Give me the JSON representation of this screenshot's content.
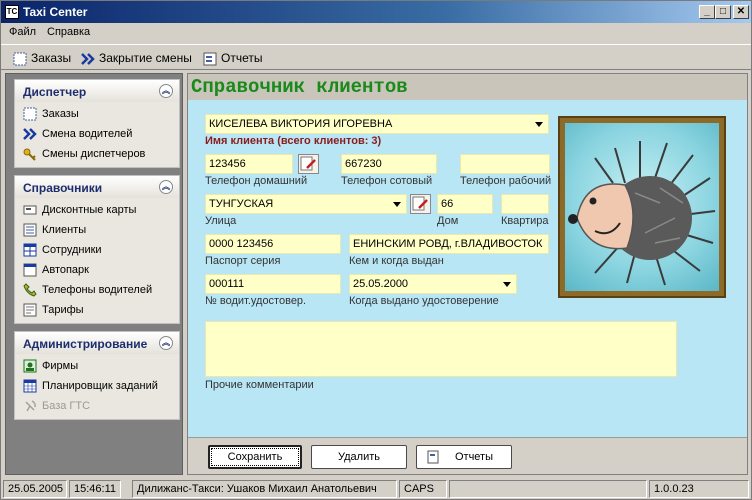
{
  "window": {
    "title": "Taxi Center",
    "minimize": "_",
    "maximize": "□",
    "close": "✕"
  },
  "menu": [
    "Файл",
    "Справка"
  ],
  "toolbar": {
    "orders": "Заказы",
    "shift_close": "Закрытие смены",
    "reports": "Отчеты"
  },
  "sidebar": {
    "dispatcher": {
      "title": "Диспетчер",
      "items": [
        "Заказы",
        "Смена водителей",
        "Смены диспетчеров"
      ]
    },
    "references": {
      "title": "Справочники",
      "items": [
        "Дисконтные карты",
        "Клиенты",
        "Сотрудники",
        "Автопарк",
        "Телефоны водителей",
        "Тарифы"
      ]
    },
    "admin": {
      "title": "Администрирование",
      "items": [
        "Фирмы",
        "Планировщик заданий",
        "База ГТС"
      ]
    }
  },
  "main": {
    "heading": "Справочник клиентов",
    "client_name": "КИСЕЛЕВА ВИКТОРИЯ ИГОРЕВНА",
    "client_name_label": "Имя клиента (всего клиентов: 3)",
    "phone_home": "123456",
    "phone_home_label": "Телефон домашний",
    "phone_mobile": "667230",
    "phone_mobile_label": "Телефон сотовый",
    "phone_work": "",
    "phone_work_label": "Телефон рабочий",
    "street": "ТУНГУСКАЯ",
    "street_label": "Улица",
    "house": "66",
    "house_label": "Дом",
    "apartment": "",
    "apartment_label": "Квартира",
    "passport": "0000 123456",
    "passport_label": "Паспорт серия",
    "issued_by": "ЕНИНСКИМ РОВД, г.ВЛАДИВОСТОК",
    "issued_by_label": "Кем и когда выдан",
    "license": "000111",
    "license_label": "№ водит.удостовер.",
    "license_date": "25.05.2000",
    "license_date_label": "Когда выдано удостоверение",
    "comments": "",
    "comments_label": "Прочие комментарии",
    "save": "Сохранить",
    "delete": "Удалить",
    "reports": "Отчеты"
  },
  "status": {
    "date": "25.05.2005",
    "time": "15:46:11",
    "user": "Дилижанс-Такси: Ушаков Михаил Анатольевич",
    "caps": "CAPS",
    "version": "1.0.0.23"
  },
  "colors": {
    "heading": "#1a8a1a",
    "field_bg": "#ffffc8",
    "content_bg": "#b9e6f5",
    "title_bar": "#0a246a"
  }
}
